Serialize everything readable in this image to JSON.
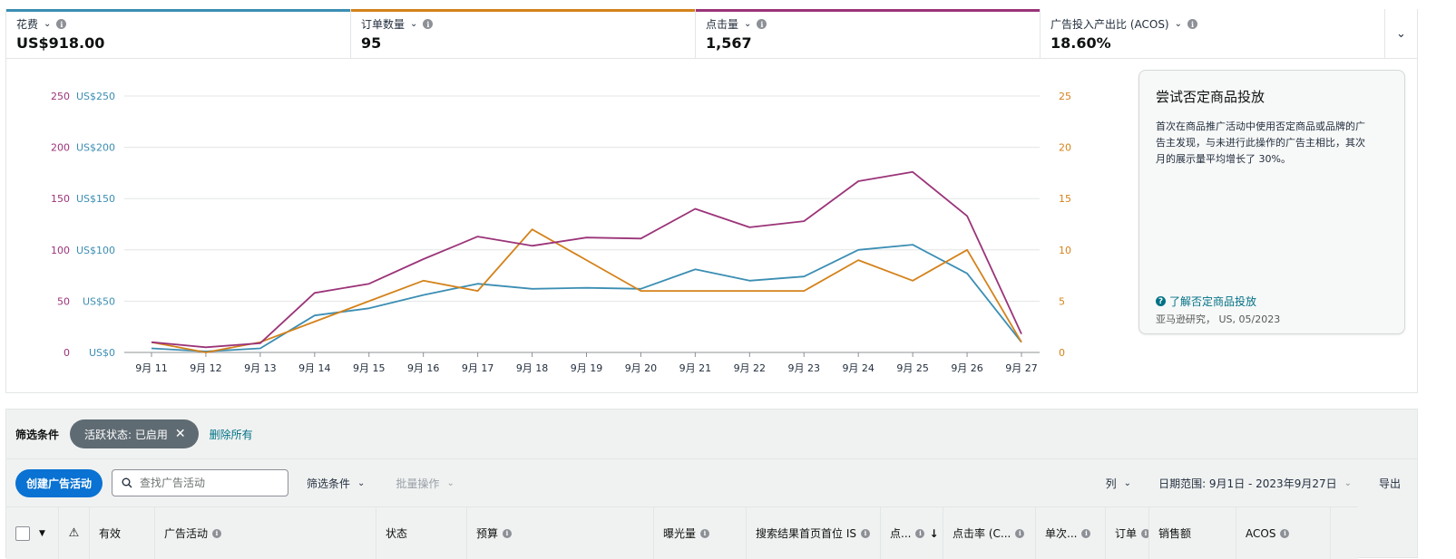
{
  "metrics": [
    {
      "label": "花费",
      "value": "US$918.00",
      "color": "#3b8eb3"
    },
    {
      "label": "订单数量",
      "value": "95",
      "color": "#d4821a"
    },
    {
      "label": "点击量",
      "value": "1,567",
      "color": "#9b3479"
    },
    {
      "label": "广告投入产出比 (ACOS)",
      "value": "18.60%",
      "color": "#8d9096"
    }
  ],
  "chart_data": {
    "type": "line",
    "x": [
      "9月 11",
      "9月 12",
      "9月 13",
      "9月 14",
      "9月 15",
      "9月 16",
      "9月 17",
      "9月 18",
      "9月 19",
      "9月 20",
      "9月 21",
      "9月 22",
      "9月 23",
      "9月 24",
      "9月 25",
      "9月 26",
      "9月 27"
    ],
    "left_axis_clicks_ticks": [
      "250",
      "200",
      "150",
      "100",
      "50",
      "0"
    ],
    "left_axis_spend_ticks": [
      "US$250",
      "US$200",
      "US$150",
      "US$100",
      "US$50",
      "US$0"
    ],
    "right_axis_orders_ticks": [
      "25",
      "20",
      "15",
      "10",
      "5",
      "0"
    ],
    "ylim_left": [
      0,
      250
    ],
    "ylim_right": [
      0,
      25
    ],
    "grid": true,
    "series": [
      {
        "name": "花费",
        "axis": "left",
        "color": "#3b8eb3",
        "values": [
          4,
          1,
          4,
          36,
          43,
          56,
          67,
          62,
          63,
          62,
          81,
          70,
          74,
          100,
          105,
          77,
          10
        ]
      },
      {
        "name": "订单数量",
        "axis": "right",
        "color": "#d4821a",
        "values": [
          1,
          0,
          1,
          3,
          5,
          7,
          6,
          12,
          9,
          6,
          6,
          6,
          6,
          9,
          7,
          10,
          1
        ]
      },
      {
        "name": "点击量",
        "axis": "left",
        "color": "#9b3479",
        "values": [
          10,
          5,
          9,
          58,
          67,
          91,
          113,
          104,
          112,
          111,
          140,
          122,
          128,
          167,
          176,
          133,
          18
        ]
      }
    ]
  },
  "tip": {
    "title": "尝试否定商品投放",
    "body": "首次在商品推广活动中使用否定商品或品牌的广告主发现，与未进行此操作的广告主相比，其次月的展示量平均增长了 30%。",
    "link": "了解否定商品投放",
    "source": "亚马逊研究， US, 05/2023"
  },
  "filters": {
    "title": "筛选条件",
    "chip": "活跃状态: 已启用",
    "clear": "删除所有"
  },
  "toolbar": {
    "create": "创建广告活动",
    "search_placeholder": "查找广告活动",
    "filter": "筛选条件",
    "bulk": "批量操作",
    "columns": "列",
    "date_range": "日期范围: 9月1日 - 2023年9月27日",
    "export": "导出"
  },
  "table": {
    "headers": [
      "有效",
      "广告活动",
      "状态",
      "预算",
      "曝光量",
      "搜索结果首页首位 IS",
      "点...",
      "点击率 (C...",
      "单次...",
      "订单",
      "销售额",
      "ACOS"
    ]
  }
}
